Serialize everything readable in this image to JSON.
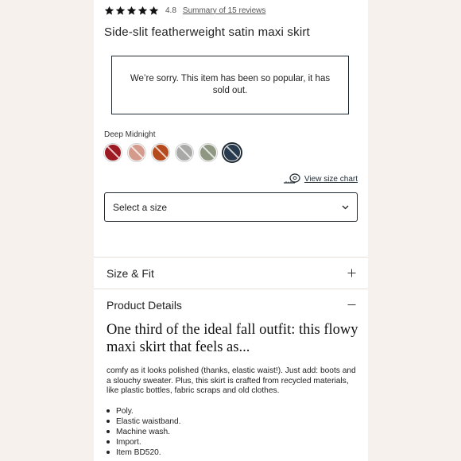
{
  "rating": {
    "value": "4.8",
    "stars": 5,
    "summary_link": "Summary of 15 reviews"
  },
  "product": {
    "title": "Side-slit featherweight satin maxi skirt",
    "soldout_message": "We’re sorry. This item has been so popular, it has sold out."
  },
  "color": {
    "selected_name": "Deep Midnight",
    "swatches": [
      {
        "name": "red",
        "hex": "#9e1a22"
      },
      {
        "name": "blush",
        "hex": "#d49b8c"
      },
      {
        "name": "rust",
        "hex": "#b44a1e"
      },
      {
        "name": "silver",
        "hex": "#a9a9a7"
      },
      {
        "name": "sage",
        "hex": "#8f9782"
      },
      {
        "name": "deep-midnight",
        "hex": "#283a4e",
        "selected": true
      }
    ]
  },
  "size_chart": {
    "icon": "measuring-tape-icon",
    "link": "View size chart"
  },
  "size_select": {
    "value": "Select a size",
    "icon": "chevron-down-icon"
  },
  "accordion": {
    "size_fit": {
      "label": "Size & Fit",
      "icon": "plus-icon"
    },
    "product_details": {
      "label": "Product Details",
      "icon": "minus-icon"
    }
  },
  "details": {
    "heading": "One third of the ideal fall outfit: this flowy maxi skirt that feels as...",
    "body": "comfy as it looks polished (thanks, elastic waist!). Just add: boots and a slouchy sweater. Plus, this skirt is crafted from recycled materials, like plastic bottles, fabric scraps and old clothes.",
    "bullets": [
      "Poly.",
      "Elastic waistband.",
      "Machine wash.",
      "Import.",
      "Item BD520."
    ]
  }
}
